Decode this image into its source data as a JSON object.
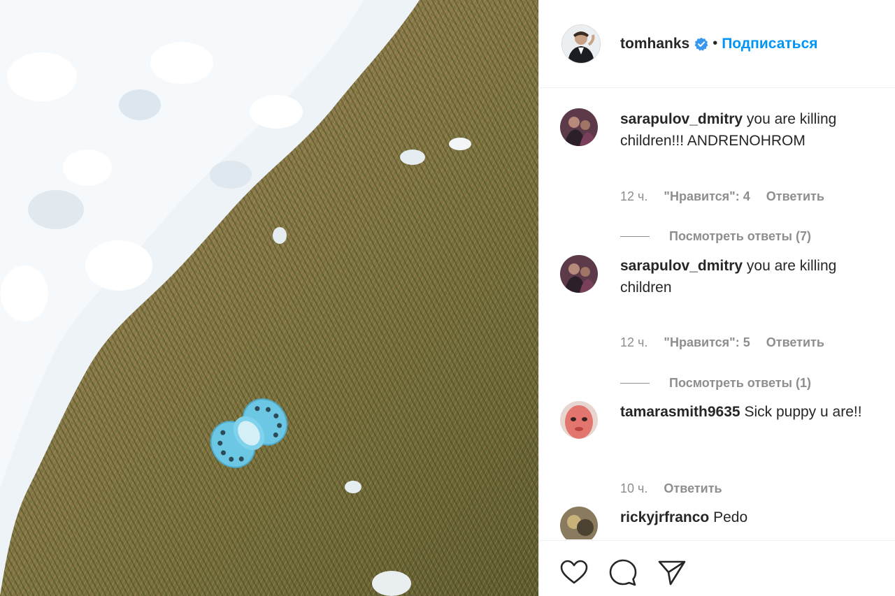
{
  "post": {
    "author": "tomhanks",
    "follow_label": "Подписаться",
    "separator": "•",
    "verified_icon": "verified-badge-icon"
  },
  "comments": [
    {
      "user": "sarapulov_dmitry",
      "text": "you are killing children!!! ANDRENOHROM",
      "time": "12 ч.",
      "likes": "\"Нравится\": 4",
      "reply_label": "Ответить",
      "view_replies": "Посмотреть ответы (7)"
    },
    {
      "user": "sarapulov_dmitry",
      "text": "you are killing children",
      "time": "12 ч.",
      "likes": "\"Нравится\": 5",
      "reply_label": "Ответить",
      "view_replies": "Посмотреть ответы (1)"
    },
    {
      "user": "tamarasmith9635",
      "text": "Sick puppy u are!!",
      "time": "10 ч.",
      "reply_label": "Ответить"
    },
    {
      "user": "rickyjrfranco",
      "text": "Pedo"
    }
  ],
  "actions": {
    "like_icon": "heart-icon",
    "comment_icon": "comment-bubble-icon",
    "share_icon": "paper-plane-icon"
  },
  "colors": {
    "link": "#0095f6",
    "meta": "#8e8e8e",
    "text": "#262626",
    "pacifier": "#6cc7e4"
  }
}
